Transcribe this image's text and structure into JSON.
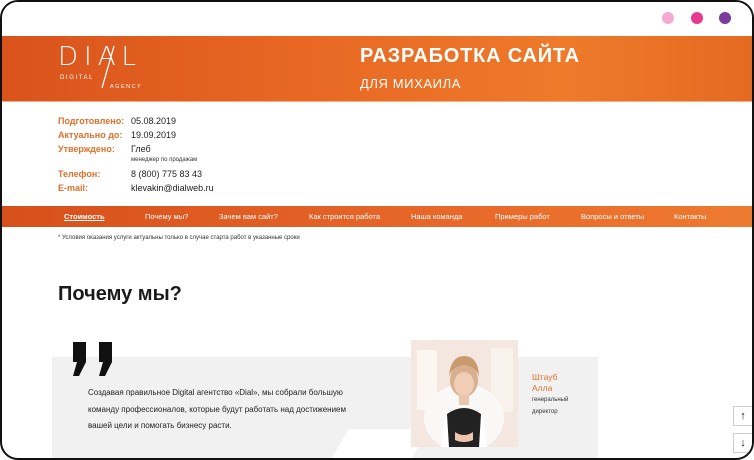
{
  "header": {
    "logo": {
      "main": "DIAL",
      "sub_left": "DIGITAL",
      "sub_right": "AGENCY"
    },
    "title": "РАЗРАБОТКА САЙТА",
    "subtitle": "ДЛЯ МИХАИЛА"
  },
  "info": {
    "prepared_label": "Подготовлено:",
    "prepared_value": "05.08.2019",
    "actual_label": "Актуально до:",
    "actual_value": "19.09.2019",
    "approved_label": "Утверждено:",
    "approved_value": "Глеб",
    "approved_note": "менеджер по продажам",
    "phone_label": "Телефон:",
    "phone_value": "8 (800) 775 83 43",
    "email_label": "E-mail:",
    "email_value": "klevakin@dialweb.ru"
  },
  "nav": {
    "items": [
      {
        "label": "Стоимость"
      },
      {
        "label": "Почему мы?"
      },
      {
        "label": "Зачем вам сайт?"
      },
      {
        "label": "Как строится работа"
      },
      {
        "label": "Наша команда"
      },
      {
        "label": "Примеры работ"
      },
      {
        "label": "Вопросы и ответы"
      },
      {
        "label": "Контакты"
      }
    ]
  },
  "footnote": "* Условия оказания услуги актуальны только в случае старта работ в указанные сроки",
  "section": {
    "title": "Почему мы?",
    "quote_lines": [
      "Создавая правильное Digital агентство «Dial», мы собрали большую",
      "команду профессионалов, которые будут работать над достижением",
      "вашей цели и помогать бизнесу расти."
    ],
    "author_name_line1": "Штауб",
    "author_name_line2": "Алла",
    "author_role_line1": "генеральный",
    "author_role_line2": "директор"
  },
  "controls": {
    "up_icon": "↑",
    "down_icon": "↓"
  },
  "colors": {
    "accent": "#e8692a",
    "dot1": "#f5a9d3",
    "dot2": "#e6398f",
    "dot3": "#7a3a9e"
  }
}
